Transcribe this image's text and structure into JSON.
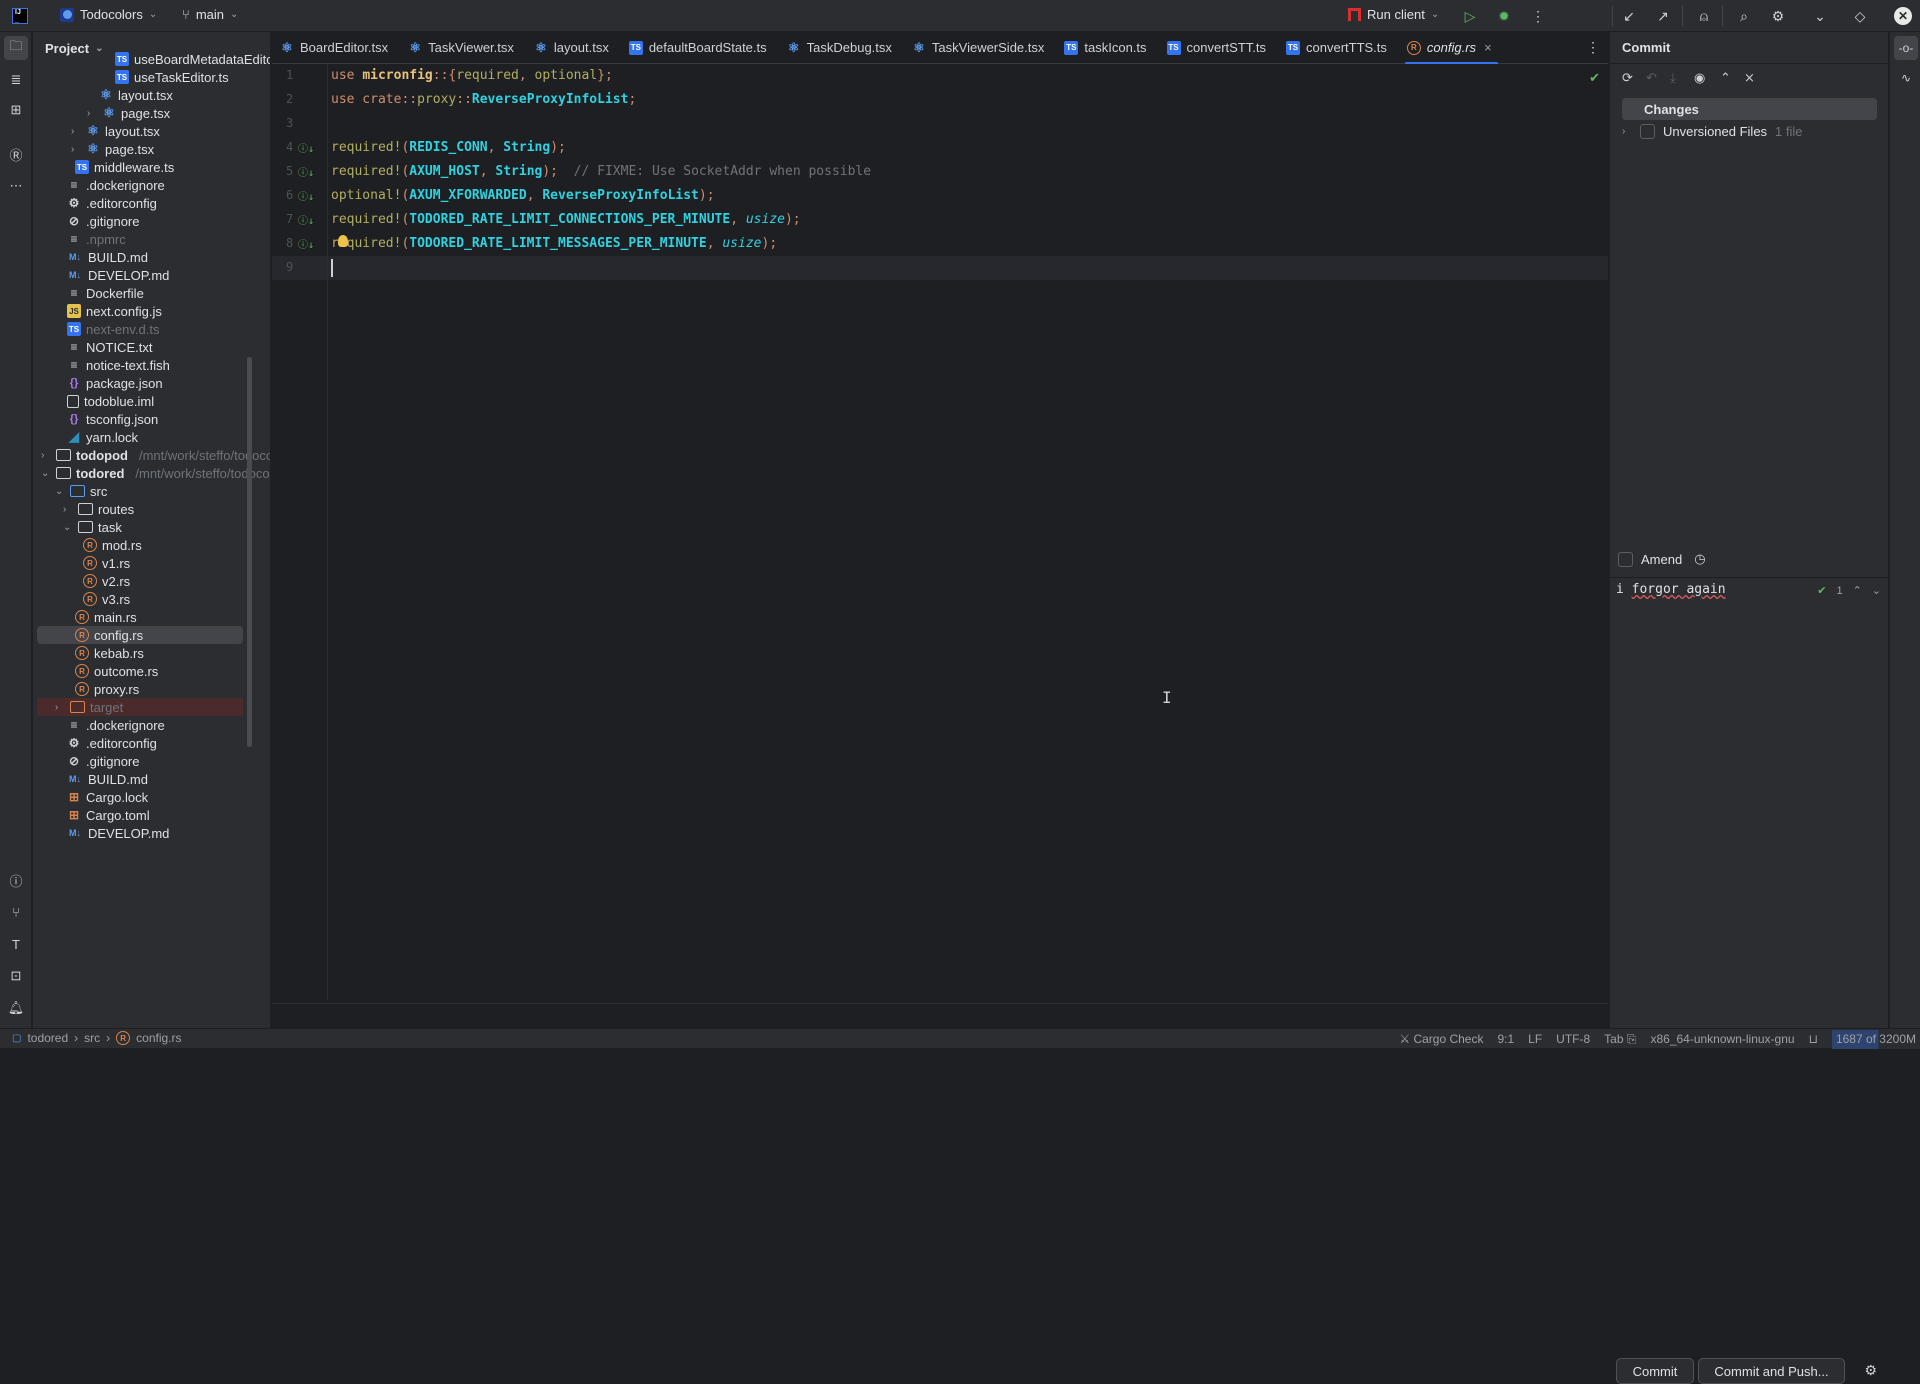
{
  "titlebar": {
    "project_name": "Todocolors",
    "branch": "main",
    "run_config": "Run client"
  },
  "project_panel": {
    "title": "Project",
    "tree": [
      {
        "label": "useBoardMetadataEditor.ts",
        "icon": "ts",
        "indent": 5
      },
      {
        "label": "useTaskEditor.ts",
        "icon": "ts",
        "indent": 5
      },
      {
        "label": "layout.tsx",
        "icon": "react",
        "indent": 4
      },
      {
        "label": "page.tsx",
        "icon": "react",
        "indent": 4,
        "arrow": "collapsed"
      },
      {
        "label": "layout.tsx",
        "icon": "react",
        "indent": 3,
        "arrow": "collapsed"
      },
      {
        "label": "page.tsx",
        "icon": "react",
        "indent": 3,
        "arrow": "collapsed"
      },
      {
        "label": "middleware.ts",
        "icon": "ts",
        "indent": 2
      },
      {
        "label": ".dockerignore",
        "icon": "txt",
        "indent": 1
      },
      {
        "label": ".editorconfig",
        "icon": "gear",
        "indent": 1
      },
      {
        "label": ".gitignore",
        "icon": "ign",
        "indent": 1
      },
      {
        "label": ".npmrc",
        "icon": "txt",
        "indent": 1,
        "dim": true
      },
      {
        "label": "BUILD.md",
        "icon": "md",
        "indent": 1
      },
      {
        "label": "DEVELOP.md",
        "icon": "md",
        "indent": 1
      },
      {
        "label": "Dockerfile",
        "icon": "txt",
        "indent": 1
      },
      {
        "label": "next.config.js",
        "icon": "js",
        "indent": 1
      },
      {
        "label": "next-env.d.ts",
        "icon": "ts",
        "indent": 1,
        "dim": true
      },
      {
        "label": "NOTICE.txt",
        "icon": "txt",
        "indent": 1
      },
      {
        "label": "notice-text.fish",
        "icon": "txt",
        "indent": 1
      },
      {
        "label": "package.json",
        "icon": "json",
        "indent": 1
      },
      {
        "label": "todoblue.iml",
        "icon": "iml",
        "indent": 1
      },
      {
        "label": "tsconfig.json",
        "icon": "json",
        "indent": 1
      },
      {
        "label": "yarn.lock",
        "icon": "yarn",
        "indent": 1
      },
      {
        "label": "todopod",
        "icon": "module",
        "indent": 0,
        "arrow": "collapsed",
        "bold": true,
        "path": "/mnt/work/steffo/todocolors/todopod"
      },
      {
        "label": "todored",
        "icon": "module",
        "indent": 0,
        "arrow": "expanded",
        "bold": true,
        "path": "/mnt/work/steffo/todocolors/todored"
      },
      {
        "label": "src",
        "icon": "src",
        "indent": 1,
        "arrow": "expanded"
      },
      {
        "label": "routes",
        "icon": "pkg",
        "indent": 2,
        "arrow": "collapsed"
      },
      {
        "label": "task",
        "icon": "pkg",
        "indent": 2,
        "arrow": "expanded"
      },
      {
        "label": "mod.rs",
        "icon": "rs",
        "indent": 3
      },
      {
        "label": "v1.rs",
        "icon": "rs",
        "indent": 3
      },
      {
        "label": "v2.rs",
        "icon": "rs",
        "indent": 3
      },
      {
        "label": "v3.rs",
        "icon": "rs",
        "indent": 3
      },
      {
        "label": "main.rs",
        "icon": "rs",
        "indent": 2
      },
      {
        "label": "config.rs",
        "icon": "rs",
        "indent": 2,
        "selected": true
      },
      {
        "label": "kebab.rs",
        "icon": "rs",
        "indent": 2
      },
      {
        "label": "outcome.rs",
        "icon": "rs",
        "indent": 2
      },
      {
        "label": "proxy.rs",
        "icon": "rs",
        "indent": 2
      },
      {
        "label": "target",
        "icon": "target",
        "indent": 1,
        "arrow": "collapsed",
        "excluded": true,
        "dim": true
      },
      {
        "label": ".dockerignore",
        "icon": "txt",
        "indent": 1
      },
      {
        "label": ".editorconfig",
        "icon": "gear",
        "indent": 1
      },
      {
        "label": ".gitignore",
        "icon": "ign",
        "indent": 1
      },
      {
        "label": "BUILD.md",
        "icon": "md",
        "indent": 1
      },
      {
        "label": "Cargo.lock",
        "icon": "cargo",
        "indent": 1
      },
      {
        "label": "Cargo.toml",
        "icon": "cargo",
        "indent": 1
      },
      {
        "label": "DEVELOP.md",
        "icon": "md",
        "indent": 1
      }
    ]
  },
  "tabs": [
    {
      "label": "BoardEditor.tsx",
      "icon": "react"
    },
    {
      "label": "TaskViewer.tsx",
      "icon": "react"
    },
    {
      "label": "layout.tsx",
      "icon": "react"
    },
    {
      "label": "defaultBoardState.ts",
      "icon": "ts"
    },
    {
      "label": "TaskDebug.tsx",
      "icon": "react"
    },
    {
      "label": "TaskViewerSide.tsx",
      "icon": "react"
    },
    {
      "label": "taskIcon.ts",
      "icon": "ts"
    },
    {
      "label": "convertSTT.ts",
      "icon": "ts"
    },
    {
      "label": "convertTTS.ts",
      "icon": "ts"
    },
    {
      "label": "config.rs",
      "icon": "rs",
      "active": true
    }
  ],
  "editor": {
    "cursor_line": 9,
    "lines": [
      {
        "n": "1",
        "tokens": [
          [
            "kw",
            "use "
          ],
          [
            "kwb",
            "micronfig"
          ],
          [
            "pn",
            "::{"
          ],
          [
            "mac",
            "required"
          ],
          [
            "pn",
            ", "
          ],
          [
            "mac",
            "optional"
          ],
          [
            "pn",
            "};"
          ]
        ]
      },
      {
        "n": "2",
        "tokens": [
          [
            "kw",
            "use crate"
          ],
          [
            "pn",
            "::"
          ],
          [
            "mac",
            "proxy"
          ],
          [
            "pn",
            "::"
          ],
          [
            "ty",
            "ReverseProxyInfoList"
          ],
          [
            "pn",
            ";"
          ]
        ]
      },
      {
        "n": "3",
        "tokens": []
      },
      {
        "n": "4",
        "mark": true,
        "tokens": [
          [
            "mac",
            "required!"
          ],
          [
            "pn",
            "("
          ],
          [
            "cn",
            "REDIS_CONN"
          ],
          [
            "pn",
            ", "
          ],
          [
            "ty",
            "String"
          ],
          [
            "pn",
            ");"
          ]
        ]
      },
      {
        "n": "5",
        "mark": true,
        "tokens": [
          [
            "mac",
            "required!"
          ],
          [
            "pn",
            "("
          ],
          [
            "cn",
            "AXUM_HOST"
          ],
          [
            "pn",
            ", "
          ],
          [
            "ty",
            "String"
          ],
          [
            "pn",
            ");  "
          ],
          [
            "cm",
            "// FIXME: Use SocketAddr when possible"
          ]
        ]
      },
      {
        "n": "6",
        "mark": true,
        "tokens": [
          [
            "mac",
            "optional!"
          ],
          [
            "pn",
            "("
          ],
          [
            "cn",
            "AXUM_XFORWARDED"
          ],
          [
            "pn",
            ", "
          ],
          [
            "ty",
            "ReverseProxyInfoList"
          ],
          [
            "pn",
            ");"
          ]
        ]
      },
      {
        "n": "7",
        "mark": true,
        "tokens": [
          [
            "mac",
            "required!"
          ],
          [
            "pn",
            "("
          ],
          [
            "cn",
            "TODORED_RATE_LIMIT_CONNECTIONS_PER_MINUTE"
          ],
          [
            "pn",
            ", "
          ],
          [
            "it",
            "usize"
          ],
          [
            "pn",
            ");"
          ]
        ]
      },
      {
        "n": "8",
        "mark": true,
        "tokens": [
          [
            "mac",
            "required!"
          ],
          [
            "pn",
            "("
          ],
          [
            "cn",
            "TODORED_RATE_LIMIT_MESSAGES_PER_MINUTE"
          ],
          [
            "pn",
            ", "
          ],
          [
            "it",
            "usize"
          ],
          [
            "pn",
            ");"
          ]
        ]
      },
      {
        "n": "9",
        "tokens": []
      }
    ]
  },
  "commit_panel": {
    "title": "Commit",
    "changes_label": "Changes",
    "unversioned_label": "Unversioned Files",
    "unversioned_count": "1 file",
    "amend_label": "Amend",
    "message": "i forgor again",
    "check_count": "1",
    "commit_button": "Commit",
    "commit_push_button": "Commit and Push..."
  },
  "statusbar": {
    "breadcrumbs": [
      "todored",
      "src",
      "config.rs"
    ],
    "cargo_check": "Cargo Check",
    "position": "9:1",
    "line_sep": "LF",
    "encoding": "UTF-8",
    "indent": "Tab",
    "target": "x86_64-unknown-linux-gnu",
    "memory": "1687 of 3200M",
    "memory_fraction": 0.527
  }
}
